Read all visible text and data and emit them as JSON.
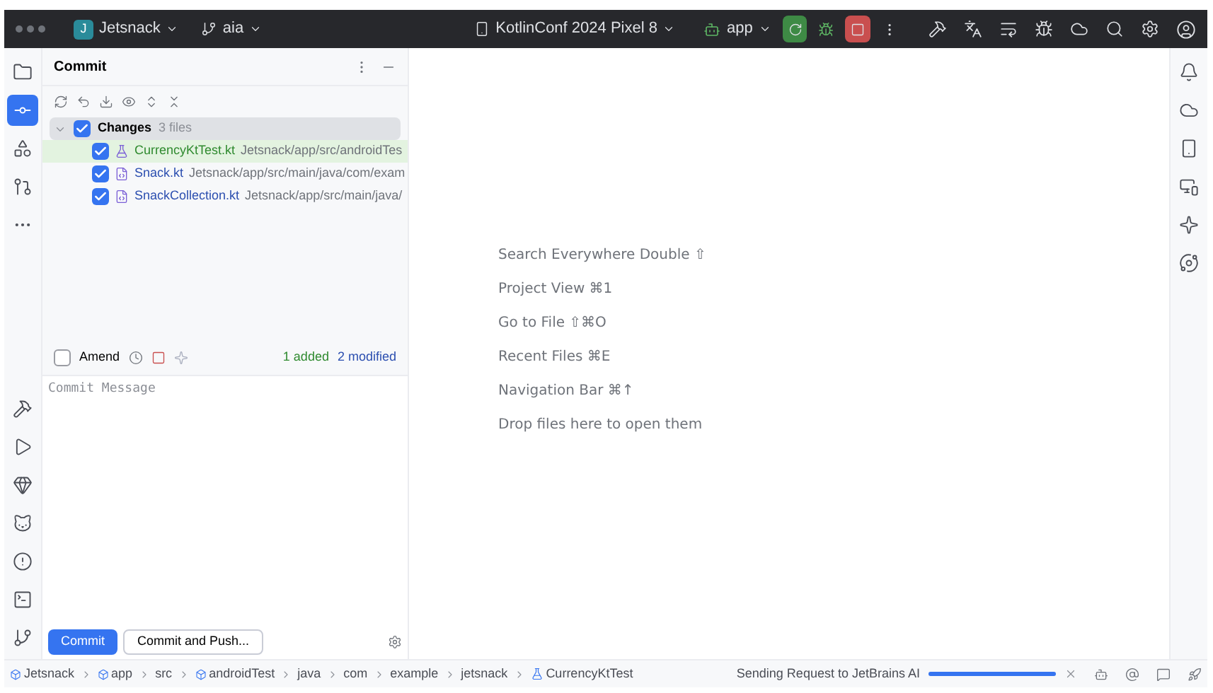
{
  "title_bar": {
    "project_initial": "J",
    "project": "Jetsnack",
    "branch": "aia",
    "device": "KotlinConf 2024 Pixel 8",
    "run_config": "app"
  },
  "left_tools": [
    {
      "kind": "folder",
      "selected": false
    },
    {
      "kind": "commit",
      "selected": true
    },
    {
      "kind": "shapes",
      "selected": false
    },
    {
      "kind": "pull",
      "selected": false
    },
    {
      "kind": "more",
      "selected": false
    }
  ],
  "left_tools_bottom": [
    {
      "kind": "hammer"
    },
    {
      "kind": "run"
    },
    {
      "kind": "gem"
    },
    {
      "kind": "cat"
    },
    {
      "kind": "problems"
    },
    {
      "kind": "terminal"
    },
    {
      "kind": "git"
    }
  ],
  "commit_panel": {
    "title": "Commit",
    "changes": {
      "label": "Changes",
      "count": "3 files",
      "checked": true,
      "expanded": true,
      "files": [
        {
          "name": "CurrencyKtTest.kt",
          "path": "Jetsnack/app/src/androidTes",
          "kind": "test",
          "color": "#2f8a2f",
          "checked": true,
          "selected": true
        },
        {
          "name": "Snack.kt",
          "path": "Jetsnack/app/src/main/java/com/exam",
          "kind": "kotlin",
          "color": "#2c4fb0",
          "checked": true,
          "selected": false
        },
        {
          "name": "SnackCollection.kt",
          "path": "Jetsnack/app/src/main/java/",
          "kind": "kotlin",
          "color": "#2c4fb0",
          "checked": true,
          "selected": false
        }
      ]
    },
    "amend": {
      "label": "Amend",
      "checked": false
    },
    "summary": [
      {
        "text": "1 added",
        "kind": "added"
      },
      {
        "text": "2 modified",
        "kind": "modified"
      }
    ],
    "message_placeholder": "Commit Message",
    "buttons": [
      {
        "label": "Commit",
        "kind": "primary"
      },
      {
        "label": "Commit and Push...",
        "kind": "secondary"
      }
    ]
  },
  "editor_hints": [
    "Search Everywhere Double ⇧",
    "Project View ⌘1",
    "Go to File ⇧⌘O",
    "Recent Files ⌘E",
    "Navigation Bar ⌘↑",
    "Drop files here to open them"
  ],
  "right_tools": [
    {
      "kind": "bell"
    },
    {
      "kind": "elephant"
    },
    {
      "kind": "device"
    },
    {
      "kind": "device-manager"
    },
    {
      "kind": "sparkle"
    },
    {
      "kind": "spiral"
    }
  ],
  "status_bar": {
    "breadcrumbs": [
      {
        "label": "Jetsnack",
        "kind": "module"
      },
      {
        "label": "app",
        "kind": "module"
      },
      {
        "label": "src",
        "kind": "folder"
      },
      {
        "label": "androidTest",
        "kind": "module"
      },
      {
        "label": "java",
        "kind": "folder"
      },
      {
        "label": "com",
        "kind": "folder"
      },
      {
        "label": "example",
        "kind": "folder"
      },
      {
        "label": "jetsnack",
        "kind": "folder"
      },
      {
        "label": "CurrencyKtTest",
        "kind": "test"
      }
    ],
    "task": "Sending Request to JetBrains AI",
    "level": 1
  }
}
